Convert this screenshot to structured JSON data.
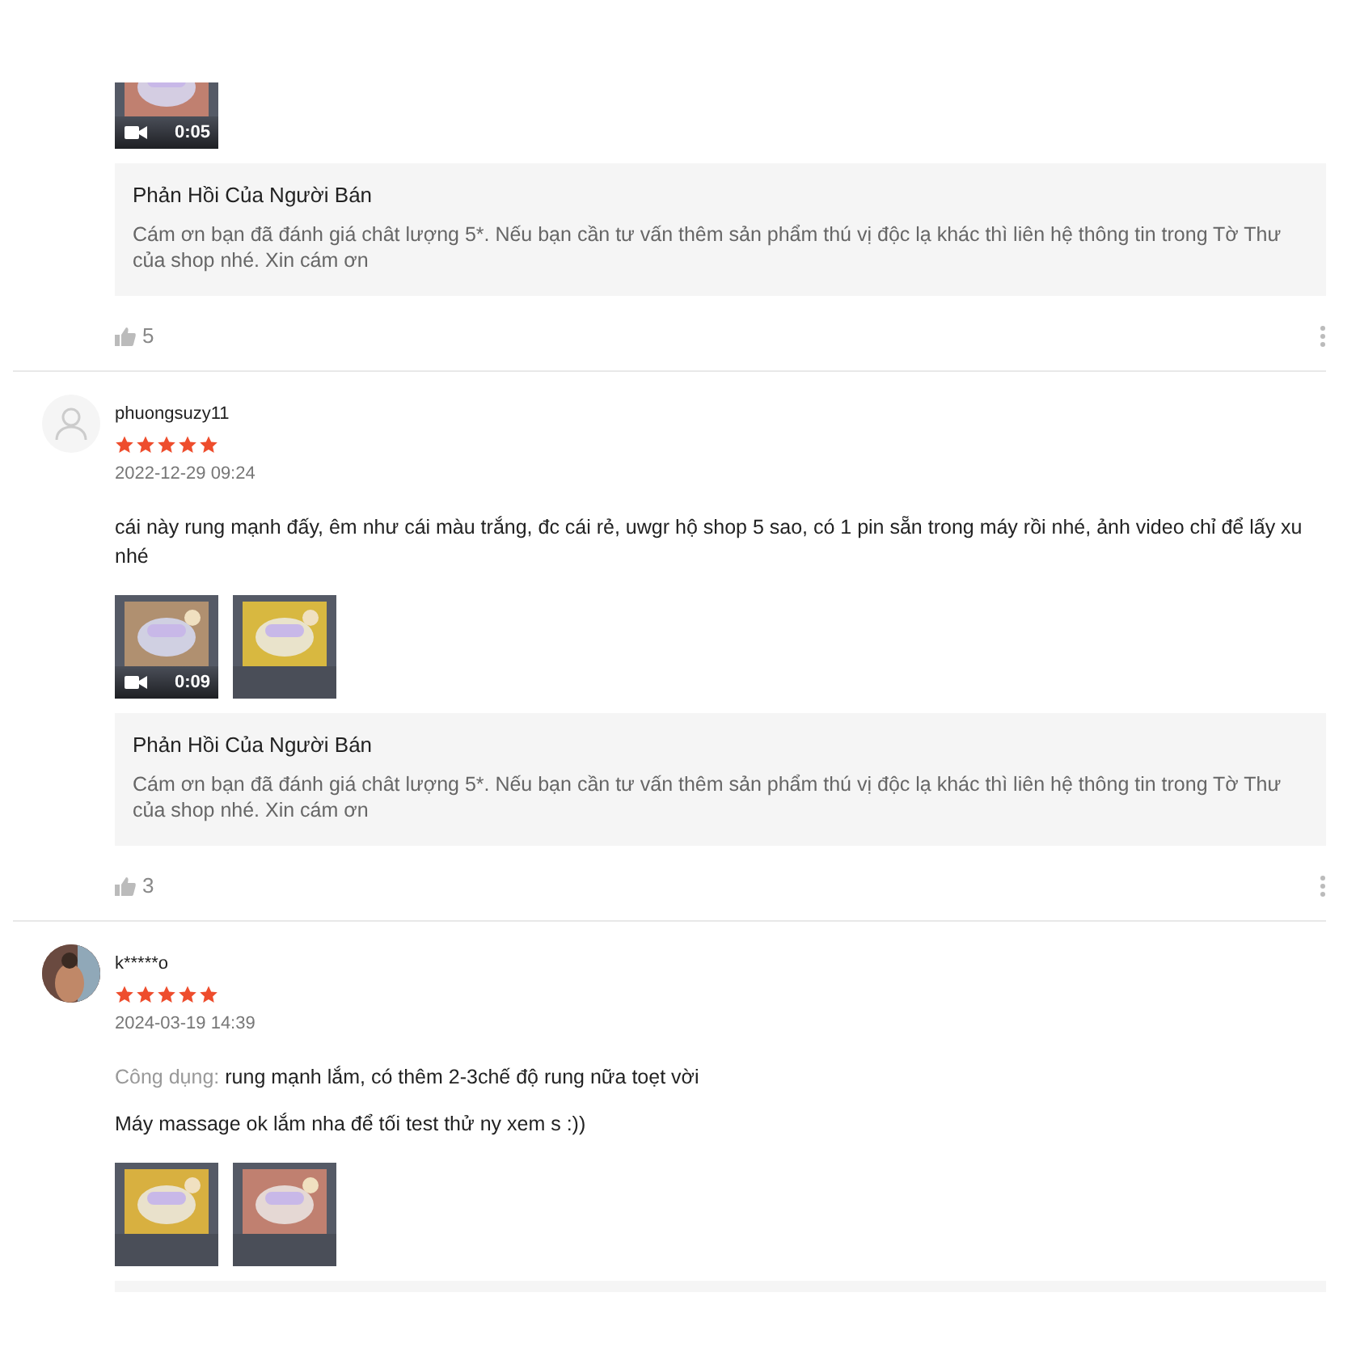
{
  "reviews": [
    {
      "media_cut": true,
      "media": [
        {
          "kind": "video",
          "duration": "0:05"
        }
      ],
      "seller_reply": {
        "title": "Phản Hồi Của Người Bán",
        "text": "Cám ơn bạn đã đánh giá chât lượng 5*. Nếu bạn cần tư vấn thêm sản phẩm thú vị độc lạ khác thì liên hệ thông tin trong Tờ Thư của shop nhé. Xin cám ơn"
      },
      "likes": "5"
    },
    {
      "avatar": {
        "kind": "icon"
      },
      "username": "phuongsuzy11",
      "stars": 5,
      "date": "2022-12-29 09:24",
      "comment": [
        {
          "text": "cái này rung mạnh đấy, êm như cái màu trắng, đc cái rẻ, uwgr hộ shop 5 sao, có 1 pin sẵn trong máy rồi nhé, ảnh video chỉ để lấy xu nhé"
        }
      ],
      "media": [
        {
          "kind": "video",
          "duration": "0:09"
        },
        {
          "kind": "picture"
        }
      ],
      "seller_reply": {
        "title": "Phản Hồi Của Người Bán",
        "text": "Cám ơn bạn đã đánh giá chât lượng 5*. Nếu bạn cần tư vấn thêm sản phẩm thú vị độc lạ khác thì liên hệ thông tin trong Tờ Thư của shop nhé. Xin cám ơn"
      },
      "likes": "3"
    },
    {
      "avatar": {
        "kind": "picture"
      },
      "username": "k*****o",
      "stars": 5,
      "date": "2024-03-19 14:39",
      "comment": [
        {
          "label": "Công dụng:",
          "text": "rung mạnh lắm, có thêm 2-3chế độ rung nữa toẹt vời"
        },
        {
          "text": "Máy massage ok lắm nha để tối test thử ny xem s :))"
        }
      ],
      "media": [
        {
          "kind": "picture"
        },
        {
          "kind": "picture"
        }
      ],
      "reply_cut": true
    }
  ]
}
